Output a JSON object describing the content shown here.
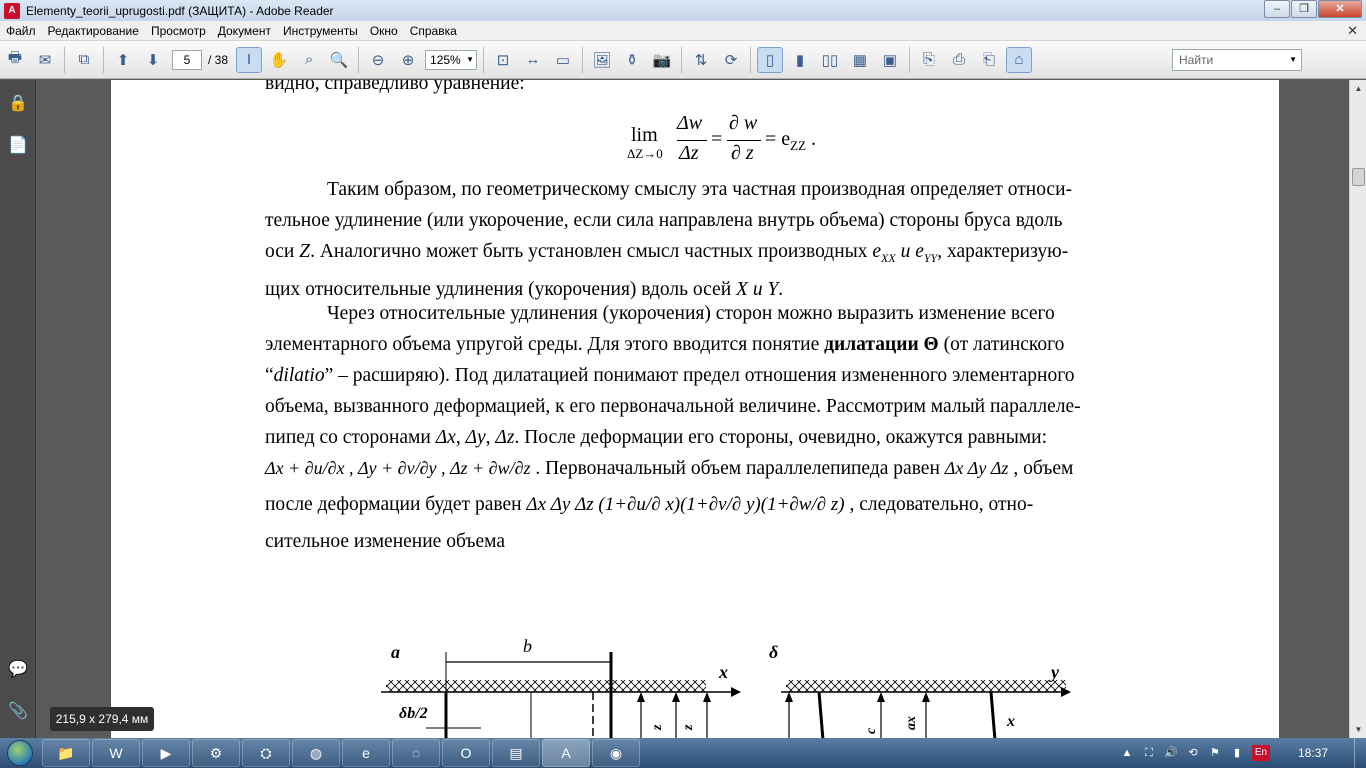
{
  "window": {
    "title": "Elementy_teorii_uprugosti.pdf (ЗАЩИТА) - Adobe Reader",
    "minimize": "–",
    "restore": "❐",
    "close": "✕"
  },
  "menu": {
    "items": [
      "Файл",
      "Редактирование",
      "Просмотр",
      "Документ",
      "Инструменты",
      "Окно",
      "Справка"
    ],
    "close_doc": "✕"
  },
  "toolbar": {
    "current_page": "5",
    "total_pages": "/ 38",
    "zoom": "125%",
    "search_placeholder": "Найти"
  },
  "document": {
    "line0": "видно, справедливо уравнение:",
    "formula1": {
      "lim": "lim",
      "lim_sub": "ΔZ→0",
      "num1": "Δw",
      "den1": "Δz",
      "num2": "∂ w",
      "den2": "∂ z",
      "rhs": "= e",
      "rhs_sub": "ZZ",
      "tail": " ."
    },
    "para1": {
      "l1": "Таким образом, по геометрическому смыслу эта частная производная определяет относи-",
      "l2": "тельное удлинение (или укорочение, если сила направлена внутрь объема) стороны бруса вдоль",
      "l3_a": "оси ",
      "l3_z": "Z",
      "l3_b": ". Аналогично может быть установлен смысл частных производных ",
      "l3_exx": "e",
      "l3_exx_sub": "XX",
      "l3_and": " и ",
      "l3_eyy": "e",
      "l3_eyy_sub": "YY",
      "l3_c": ", характеризую-",
      "l4_a": "щих относительные удлинения (укорочения) вдоль осей ",
      "l4_x": "X",
      "l4_and": " и ",
      "l4_y": "Y",
      "l4_end": "."
    },
    "para2": {
      "l1": "Через относительные удлинения (укорочения) сторон можно выразить изменение всего",
      "l2_a": "элементарного объема упругой среды. Для этого вводится понятие ",
      "l2_bold": "дилатации Θ",
      "l2_b": " (от латинского",
      "l3_a": "“",
      "l3_it": "dilatio",
      "l3_b": "” – расширяю). Под дилатацией понимают предел отношения измененного элементарного",
      "l4": "объема, вызванного деформацией, к его первоначальной величине. Рассмотрим малый параллеле-",
      "l5_a": "пипед со сторонами ",
      "l5_dx": "Δx",
      "l5_sep1": ", ",
      "l5_dy": "Δy",
      "l5_sep2": ", ",
      "l5_dz": "Δz",
      "l5_b": ". После деформации его стороны, очевидно, окажутся равными:",
      "l6_f": "Δx + ∂u/∂x , Δy + ∂v/∂y , Δz + ∂w/∂z",
      "l6_b": " . Первоначальный объем параллелепипеда равен ",
      "l6_f2": "Δx Δy Δz",
      "l6_c": " , объем",
      "l7_a": "после деформации будет равен ",
      "l7_f": "Δx Δy Δz (1+∂u/∂ x)(1+∂v/∂ y)(1+∂w/∂ z)",
      "l7_b": " , следовательно, отно-",
      "l8": "сительное изменение объема"
    },
    "figure": {
      "label_a": "a",
      "label_b_dim": "b",
      "label_x": "x",
      "label_db2": "δb/2",
      "label_z1": "z",
      "label_z2": "z",
      "label_delta": "δ",
      "label_y": "y",
      "label_c": "c",
      "label_ax": "ax",
      "label_x2": "x"
    }
  },
  "status": {
    "page_size": "215,9 x 279,4 мм"
  },
  "taskbar": {
    "clock": "18:37",
    "lang": "En"
  },
  "colors": {
    "titlebar": "#c5d6ea",
    "toolbar": "#e3e3e3",
    "docbg": "#5a5a5a",
    "taskbar": "#2b4d74",
    "acrobat_red": "#c8102e"
  }
}
